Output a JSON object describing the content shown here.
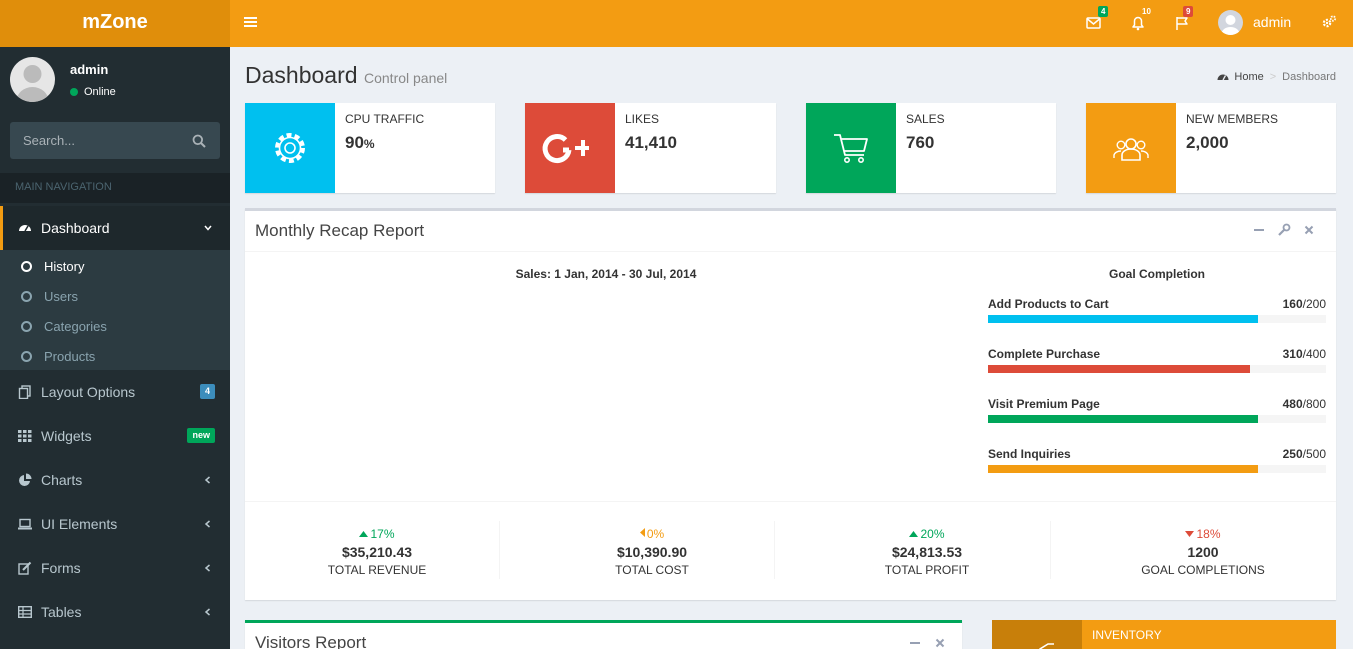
{
  "app": {
    "logo": "mZone"
  },
  "header": {
    "badges": {
      "mail": "4",
      "notifications": "10",
      "flags": "9"
    },
    "user_name": "admin",
    "icons": [
      "menu-icon",
      "envelope-icon",
      "bell-icon",
      "flag-icon",
      "gears-icon"
    ]
  },
  "sidebar": {
    "user": {
      "name": "admin",
      "status": "Online"
    },
    "search_placeholder": "Search...",
    "nav_header": "MAIN NAVIGATION",
    "items": [
      {
        "label": "Dashboard",
        "icon": "dashboard-icon"
      },
      {
        "label": "Layout Options",
        "icon": "files-icon",
        "badge": "4"
      },
      {
        "label": "Widgets",
        "icon": "th-icon",
        "badge": "new"
      },
      {
        "label": "Charts",
        "icon": "pie-chart-icon"
      },
      {
        "label": "UI Elements",
        "icon": "laptop-icon"
      },
      {
        "label": "Forms",
        "icon": "edit-icon"
      },
      {
        "label": "Tables",
        "icon": "table-icon"
      }
    ],
    "submenu": [
      "History",
      "Users",
      "Categories",
      "Products"
    ]
  },
  "page": {
    "title": "Dashboard",
    "subtitle": "Control panel",
    "breadcrumb": {
      "home": "Home",
      "current": "Dashboard"
    }
  },
  "info_boxes": [
    {
      "label": "CPU TRAFFIC",
      "value": "90",
      "unit": "%",
      "color": "#00c0ef",
      "icon": "gear-icon"
    },
    {
      "label": "LIKES",
      "value": "41,410",
      "color": "#dd4b39",
      "icon": "google-plus-icon"
    },
    {
      "label": "SALES",
      "value": "760",
      "color": "#00a65a",
      "icon": "shopping-cart-icon"
    },
    {
      "label": "NEW MEMBERS",
      "value": "2,000",
      "color": "#f39c12",
      "icon": "users-icon"
    }
  ],
  "recap": {
    "title": "Monthly Recap Report",
    "chart_title": "Sales: 1 Jan, 2014 - 30 Jul, 2014",
    "goal_title": "Goal Completion",
    "goals": [
      {
        "label": "Add Products to Cart",
        "value": "160",
        "total": "/200",
        "fraction": 0.8,
        "color": "#00c0ef"
      },
      {
        "label": "Complete Purchase",
        "value": "310",
        "total": "/400",
        "fraction": 0.775,
        "color": "#dd4b39"
      },
      {
        "label": "Visit Premium Page",
        "value": "480",
        "total": "/800",
        "fraction": 0.8,
        "color": "#00a65a"
      },
      {
        "label": "Send Inquiries",
        "value": "250",
        "total": "/500",
        "fraction": 0.8,
        "color": "#f39c12"
      }
    ],
    "stats": [
      {
        "pct": "17%",
        "amount": "$35,210.43",
        "label": "TOTAL REVENUE",
        "trend": "up",
        "color": "#00a65a"
      },
      {
        "pct": "0%",
        "amount": "$10,390.90",
        "label": "TOTAL COST",
        "trend": "left",
        "color": "#f39c12"
      },
      {
        "pct": "20%",
        "amount": "$24,813.53",
        "label": "TOTAL PROFIT",
        "trend": "up",
        "color": "#00a65a"
      },
      {
        "pct": "18%",
        "amount": "1200",
        "label": "GOAL COMPLETIONS",
        "trend": "down",
        "color": "#dd4b39"
      }
    ]
  },
  "visitors": {
    "title": "Visitors Report"
  },
  "inventory": {
    "label": "INVENTORY"
  }
}
